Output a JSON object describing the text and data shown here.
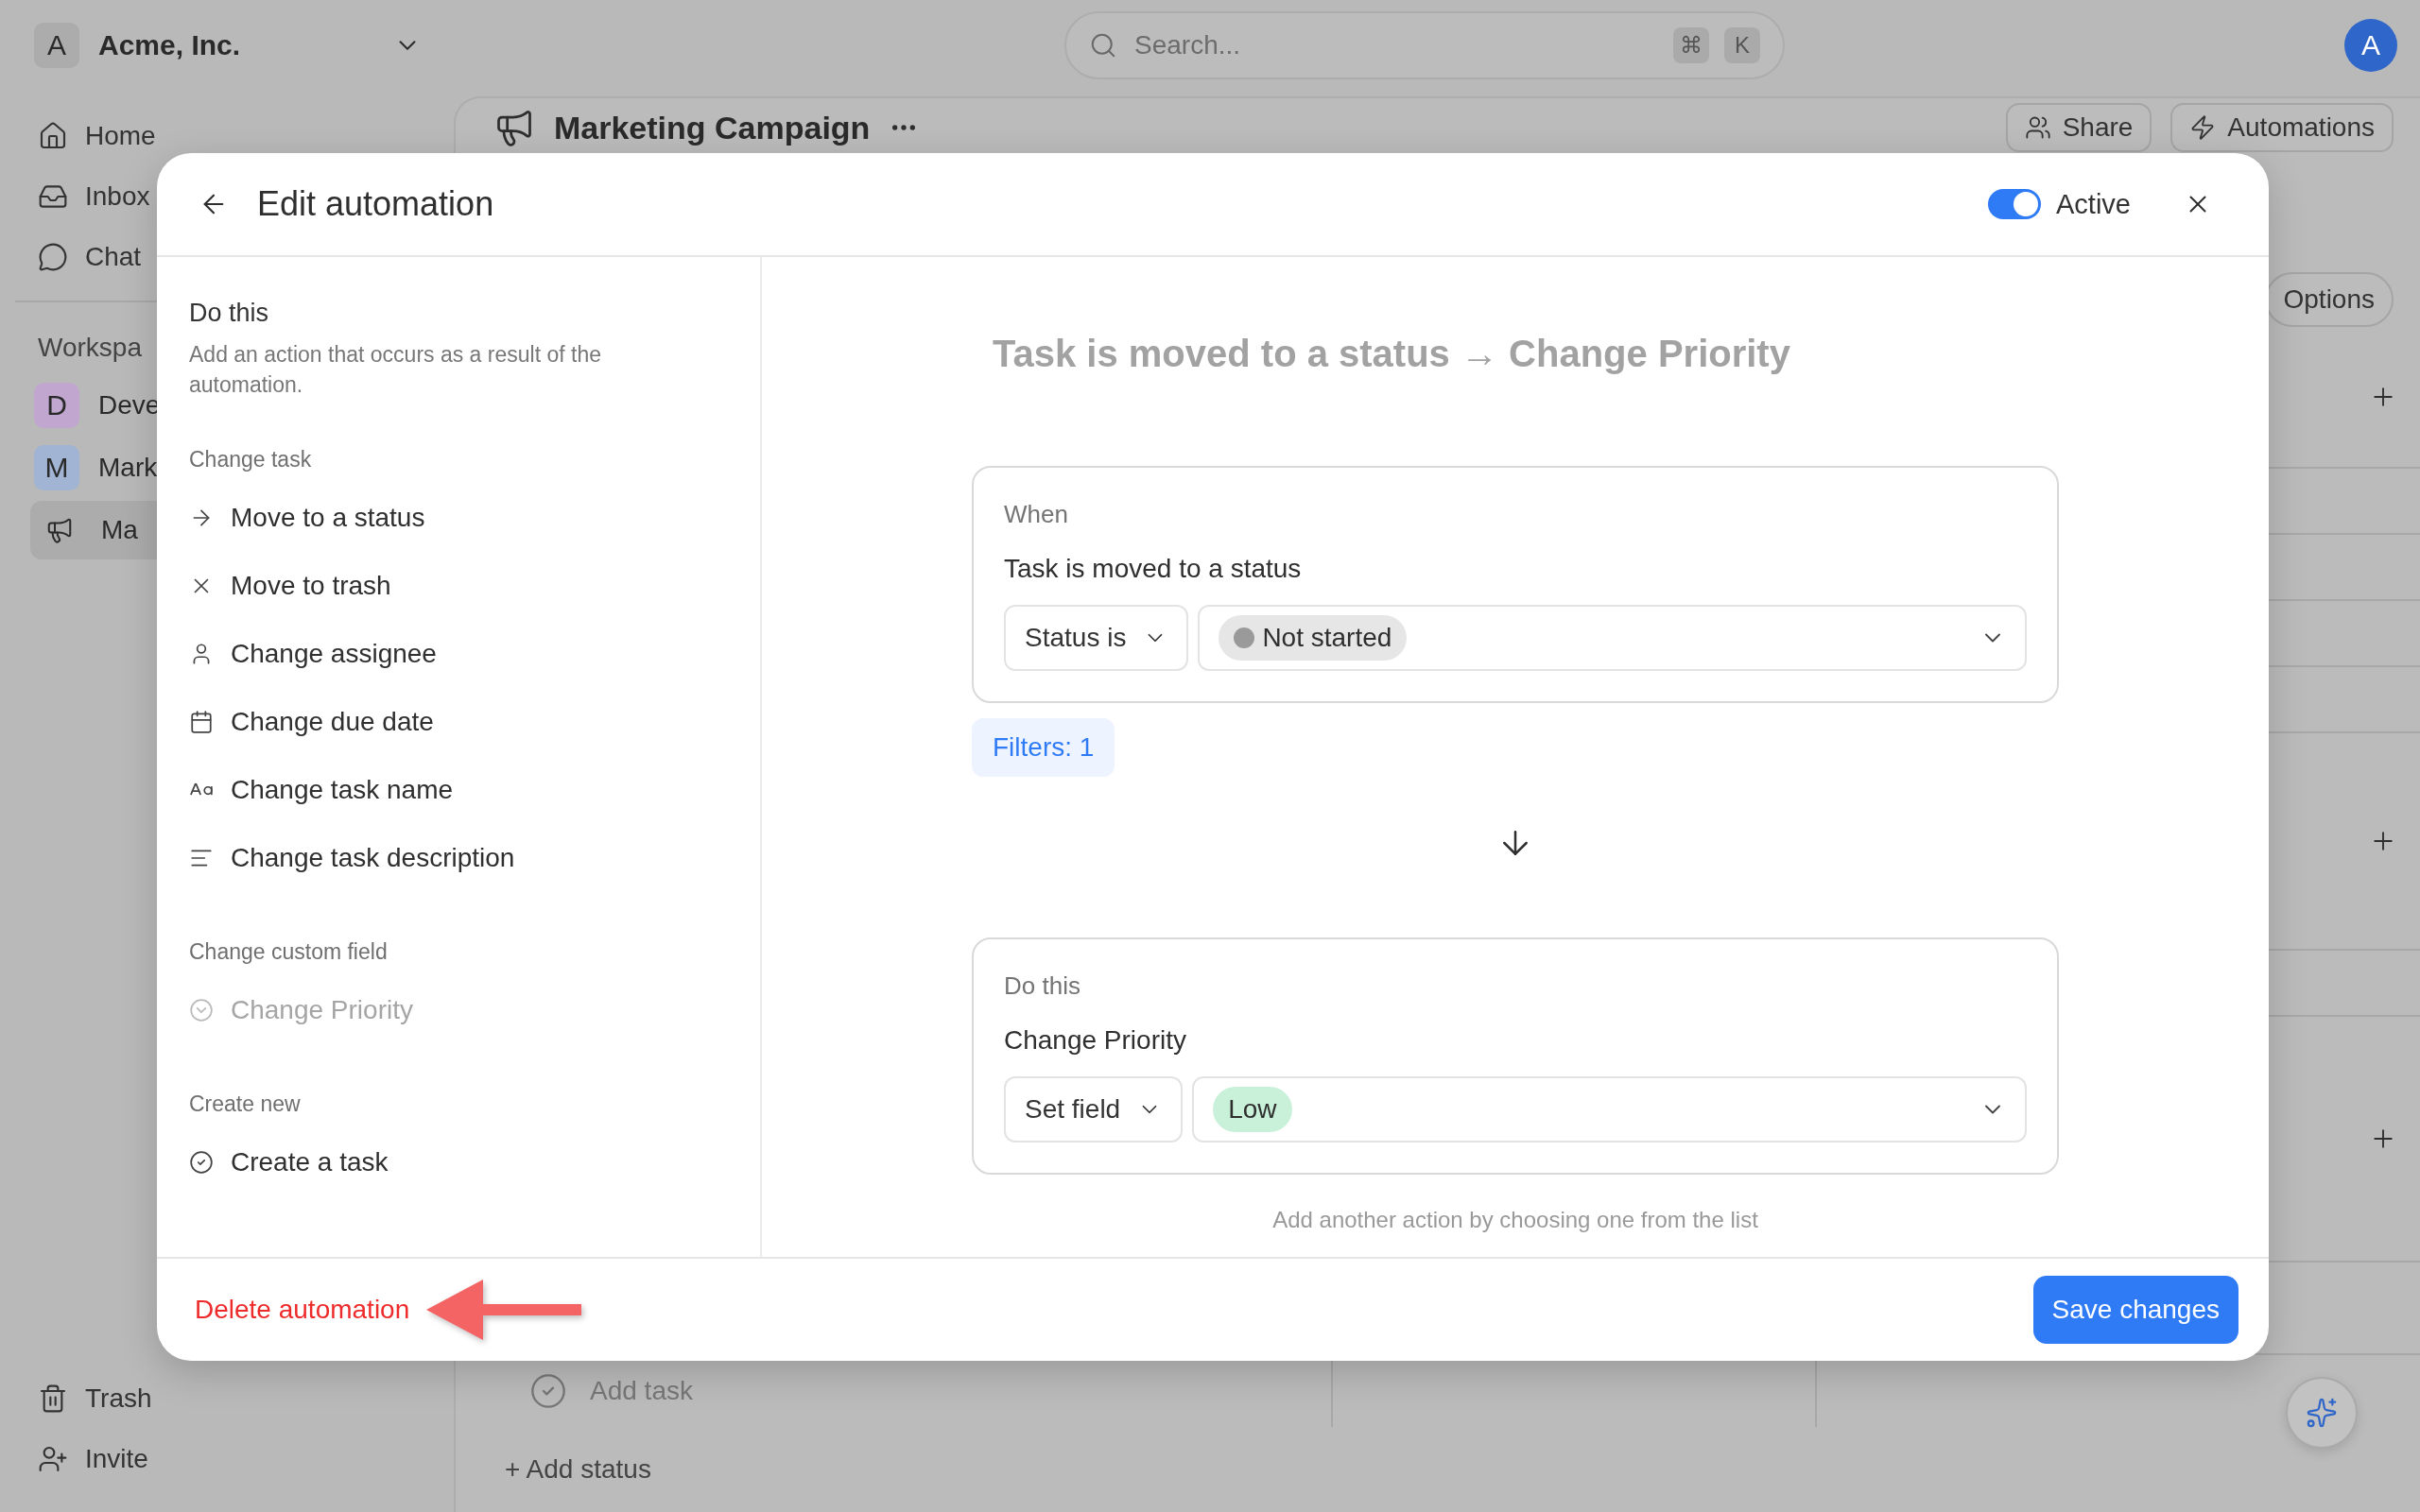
{
  "topbar": {
    "workspace": {
      "initial": "A",
      "name": "Acme, Inc."
    },
    "search": {
      "placeholder": "Search...",
      "keys": [
        "⌘",
        "K"
      ]
    },
    "avatar": "A"
  },
  "sidebar": {
    "nav": [
      {
        "kind": "home",
        "label": "Home"
      },
      {
        "kind": "inbox",
        "label": "Inbox"
      },
      {
        "kind": "chat",
        "label": "Chat"
      }
    ],
    "section": "Workspa",
    "workspaces": [
      {
        "kind": "letter",
        "initial": "D",
        "label": "Deve",
        "color": "#c1a7cf",
        "selected": false
      },
      {
        "kind": "letter",
        "initial": "M",
        "label": "Mark",
        "color": "#a1b4d4",
        "selected": false
      },
      {
        "kind": "project",
        "label": "Ma",
        "selected": true
      }
    ],
    "footer": [
      {
        "kind": "trash",
        "label": "Trash"
      },
      {
        "kind": "invite",
        "label": "Invite"
      }
    ]
  },
  "project": {
    "title": "Marketing Campaign",
    "actions": [
      {
        "kind": "share",
        "label": "Share"
      },
      {
        "kind": "automations",
        "label": "Automations"
      }
    ],
    "options": "Options",
    "add_task": "Add task",
    "add_status": "+ Add status"
  },
  "modal": {
    "title": "Edit automation",
    "active": {
      "on": true,
      "label": "Active"
    },
    "panel": {
      "title": "Do this",
      "description": "Add an action that occurs as a result of the automation.",
      "sections": [
        {
          "heading": "Change task",
          "items": [
            {
              "kind": "status",
              "label": "Move to a status",
              "disabled": false
            },
            {
              "kind": "trash",
              "label": "Move to trash",
              "disabled": false
            },
            {
              "kind": "assignee",
              "label": "Change assignee",
              "disabled": false
            },
            {
              "kind": "date",
              "label": "Change due date",
              "disabled": false
            },
            {
              "kind": "name",
              "label": "Change task name",
              "disabled": false
            },
            {
              "kind": "description",
              "label": "Change task description",
              "disabled": false
            }
          ]
        },
        {
          "heading": "Change custom field",
          "items": [
            {
              "kind": "select",
              "label": "Change Priority",
              "disabled": true
            }
          ]
        },
        {
          "heading": "Create new",
          "items": [
            {
              "kind": "task",
              "label": "Create a task",
              "disabled": false
            }
          ]
        }
      ]
    },
    "summary": "Task is moved to a status → Change Priority",
    "trigger": {
      "label": "When",
      "title": "Task is moved to a status",
      "operator": "Status is",
      "value": {
        "kind": "status",
        "text": "Not started"
      }
    },
    "filters": "Filters: 1",
    "action": {
      "label": "Do this",
      "title": "Change Priority",
      "operator": "Set field",
      "value": {
        "kind": "priority",
        "text": "Low"
      }
    },
    "hint": "Add another action by choosing one from the list",
    "delete": "Delete automation",
    "save": "Save changes"
  }
}
